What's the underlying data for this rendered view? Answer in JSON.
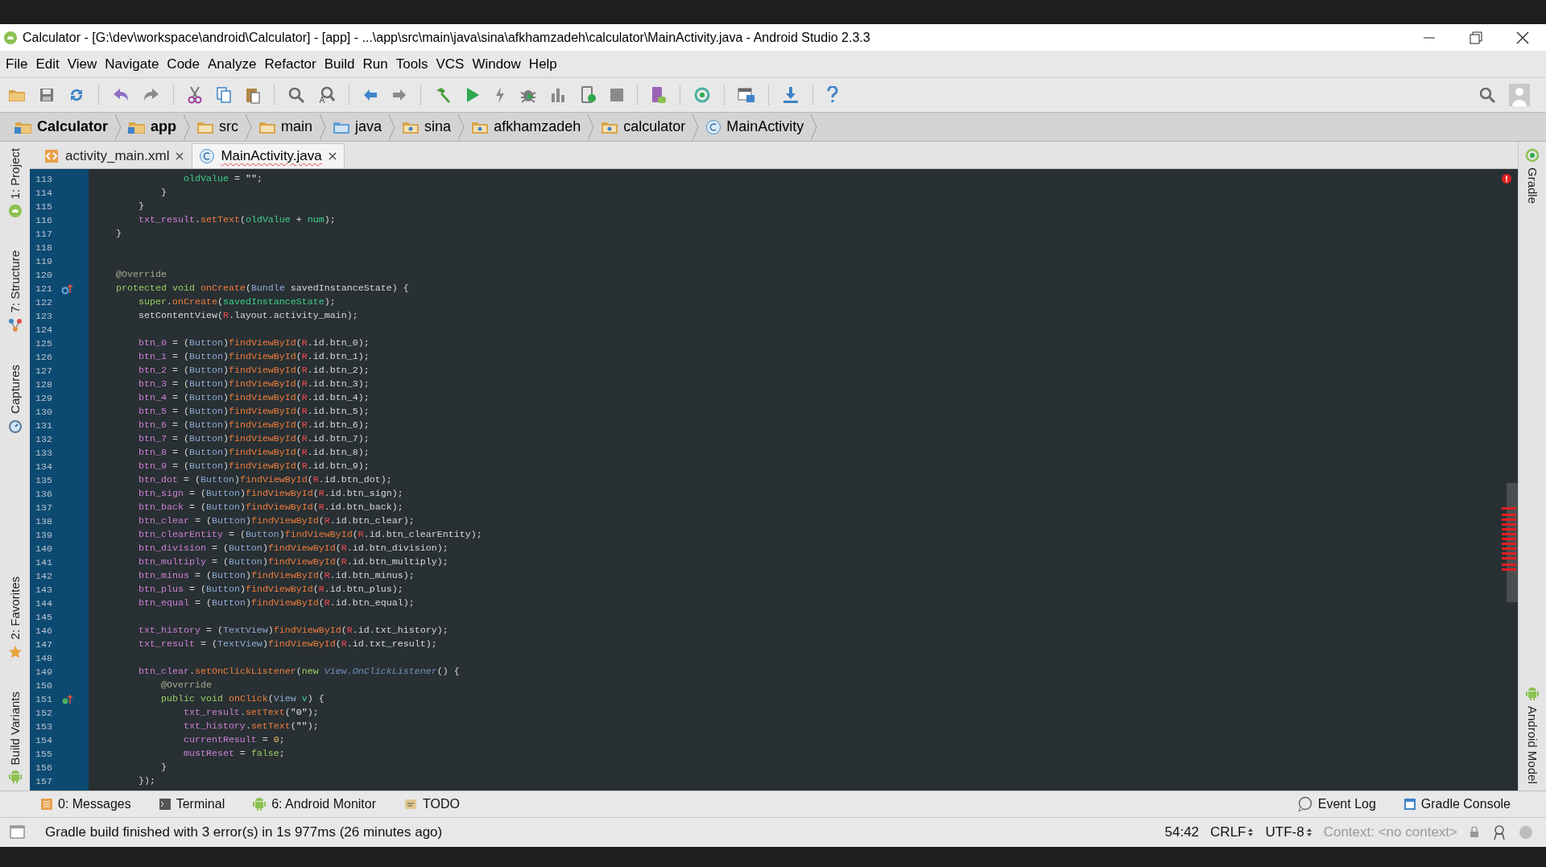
{
  "window": {
    "title": "Calculator - [G:\\dev\\workspace\\android\\Calculator] - [app] - ...\\app\\src\\main\\java\\sina\\afkhamzadeh\\calculator\\MainActivity.java - Android Studio 2.3.3"
  },
  "menu": [
    "File",
    "Edit",
    "View",
    "Navigate",
    "Code",
    "Analyze",
    "Refactor",
    "Build",
    "Run",
    "Tools",
    "VCS",
    "Window",
    "Help"
  ],
  "breadcrumbs": [
    {
      "label": "Calculator",
      "kind": "module"
    },
    {
      "label": "app",
      "kind": "module"
    },
    {
      "label": "src",
      "kind": "folder"
    },
    {
      "label": "main",
      "kind": "folder"
    },
    {
      "label": "java",
      "kind": "source"
    },
    {
      "label": "sina",
      "kind": "package"
    },
    {
      "label": "afkhamzadeh",
      "kind": "package"
    },
    {
      "label": "calculator",
      "kind": "package"
    },
    {
      "label": "MainActivity",
      "kind": "class"
    }
  ],
  "tabs": [
    {
      "label": "activity_main.xml",
      "kind": "xml",
      "selected": false
    },
    {
      "label": "MainActivity.java",
      "kind": "class",
      "selected": true
    }
  ],
  "left_toolbar": {
    "top": [
      {
        "label": "1: Project",
        "kind": "project"
      },
      {
        "label": "7: Structure",
        "kind": "structure"
      },
      {
        "label": "Captures",
        "kind": "captures"
      }
    ],
    "bottom": [
      {
        "label": "2: Favorites",
        "kind": "favorites"
      },
      {
        "label": "Build Variants",
        "kind": "android"
      }
    ]
  },
  "right_toolbar": {
    "top": [
      {
        "label": "Gradle",
        "kind": "gradle"
      }
    ],
    "bottom": [
      {
        "label": "Android Model",
        "kind": "android"
      }
    ]
  },
  "code": [
    {
      "number": "113",
      "tokens": [
        {
          "kind": "local",
          "text": "                oldValue"
        },
        {
          "kind": "plain",
          "text": " = "
        },
        {
          "kind": "string",
          "text": "\"\""
        },
        {
          "kind": "plain",
          "text": ";"
        }
      ]
    },
    {
      "number": "114",
      "tokens": [
        {
          "kind": "plain",
          "text": "            }"
        }
      ]
    },
    {
      "number": "115",
      "tokens": [
        {
          "kind": "plain",
          "text": "        }"
        }
      ]
    },
    {
      "number": "116",
      "tokens": [
        {
          "kind": "field",
          "text": "        txt_result"
        },
        {
          "kind": "plain",
          "text": "."
        },
        {
          "kind": "method",
          "text": "setText"
        },
        {
          "kind": "plain",
          "text": "("
        },
        {
          "kind": "local",
          "text": "oldValue"
        },
        {
          "kind": "plain",
          "text": " + "
        },
        {
          "kind": "local",
          "text": "num"
        },
        {
          "kind": "plain",
          "text": ");"
        }
      ]
    },
    {
      "number": "117",
      "tokens": [
        {
          "kind": "plain",
          "text": "    }"
        }
      ]
    },
    {
      "number": "118"
    },
    {
      "number": "119"
    },
    {
      "number": "120",
      "tokens": [
        {
          "kind": "annotation",
          "text": "    @Override"
        }
      ]
    },
    {
      "number": "121",
      "marker": {
        "kind": "overrides"
      },
      "tokens": [
        {
          "kind": "keyword",
          "text": "    protected void "
        },
        {
          "kind": "method",
          "text": "onCreate"
        },
        {
          "kind": "plain",
          "text": "("
        },
        {
          "kind": "type",
          "text": "Bundle"
        },
        {
          "kind": "plain",
          "text": " savedInstanceState) {"
        }
      ]
    },
    {
      "number": "122",
      "tokens": [
        {
          "kind": "keyword",
          "text": "        super"
        },
        {
          "kind": "plain",
          "text": "."
        },
        {
          "kind": "method",
          "text": "onCreate"
        },
        {
          "kind": "plain",
          "text": "("
        },
        {
          "kind": "local",
          "text": "savedInstanceState"
        },
        {
          "kind": "plain",
          "text": ");"
        }
      ]
    },
    {
      "number": "123",
      "tokens": [
        {
          "kind": "plain",
          "text": "        setContentView("
        },
        {
          "kind": "constant",
          "text": "R"
        },
        {
          "kind": "plain",
          "text": ".layout.activity_main);"
        }
      ]
    },
    {
      "number": "124"
    },
    {
      "number": "125",
      "tokens": [
        {
          "kind": "field",
          "text": "        btn_0"
        },
        {
          "kind": "plain",
          "text": " = ("
        },
        {
          "kind": "type",
          "text": "Button"
        },
        {
          "kind": "plain",
          "text": ")"
        },
        {
          "kind": "method",
          "text": "findViewById"
        },
        {
          "kind": "plain",
          "text": "("
        },
        {
          "kind": "constant",
          "text": "R"
        },
        {
          "kind": "plain",
          "text": ".id.btn_0);"
        }
      ]
    },
    {
      "number": "126",
      "tokens": [
        {
          "kind": "field",
          "text": "        btn_1"
        },
        {
          "kind": "plain",
          "text": " = ("
        },
        {
          "kind": "type",
          "text": "Button"
        },
        {
          "kind": "plain",
          "text": ")"
        },
        {
          "kind": "method",
          "text": "findViewById"
        },
        {
          "kind": "plain",
          "text": "("
        },
        {
          "kind": "constant",
          "text": "R"
        },
        {
          "kind": "plain",
          "text": ".id.btn_1);"
        }
      ]
    },
    {
      "number": "127",
      "tokens": [
        {
          "kind": "field",
          "text": "        btn_2"
        },
        {
          "kind": "plain",
          "text": " = ("
        },
        {
          "kind": "type",
          "text": "Button"
        },
        {
          "kind": "plain",
          "text": ")"
        },
        {
          "kind": "method",
          "text": "findViewById"
        },
        {
          "kind": "plain",
          "text": "("
        },
        {
          "kind": "constant",
          "text": "R"
        },
        {
          "kind": "plain",
          "text": ".id.btn_2);"
        }
      ]
    },
    {
      "number": "128",
      "tokens": [
        {
          "kind": "field",
          "text": "        btn_3"
        },
        {
          "kind": "plain",
          "text": " = ("
        },
        {
          "kind": "type",
          "text": "Button"
        },
        {
          "kind": "plain",
          "text": ")"
        },
        {
          "kind": "method",
          "text": "findViewById"
        },
        {
          "kind": "plain",
          "text": "("
        },
        {
          "kind": "constant",
          "text": "R"
        },
        {
          "kind": "plain",
          "text": ".id.btn_3);"
        }
      ]
    },
    {
      "number": "129",
      "tokens": [
        {
          "kind": "field",
          "text": "        btn_4"
        },
        {
          "kind": "plain",
          "text": " = ("
        },
        {
          "kind": "type",
          "text": "Button"
        },
        {
          "kind": "plain",
          "text": ")"
        },
        {
          "kind": "method",
          "text": "findViewById"
        },
        {
          "kind": "plain",
          "text": "("
        },
        {
          "kind": "constant",
          "text": "R"
        },
        {
          "kind": "plain",
          "text": ".id.btn_4);"
        }
      ]
    },
    {
      "number": "130",
      "tokens": [
        {
          "kind": "field",
          "text": "        btn_5"
        },
        {
          "kind": "plain",
          "text": " = ("
        },
        {
          "kind": "type",
          "text": "Button"
        },
        {
          "kind": "plain",
          "text": ")"
        },
        {
          "kind": "method",
          "text": "findViewById"
        },
        {
          "kind": "plain",
          "text": "("
        },
        {
          "kind": "constant",
          "text": "R"
        },
        {
          "kind": "plain",
          "text": ".id.btn_5);"
        }
      ]
    },
    {
      "number": "131",
      "tokens": [
        {
          "kind": "field",
          "text": "        btn_6"
        },
        {
          "kind": "plain",
          "text": " = ("
        },
        {
          "kind": "type",
          "text": "Button"
        },
        {
          "kind": "plain",
          "text": ")"
        },
        {
          "kind": "method",
          "text": "findViewById"
        },
        {
          "kind": "plain",
          "text": "("
        },
        {
          "kind": "constant",
          "text": "R"
        },
        {
          "kind": "plain",
          "text": ".id.btn_6);"
        }
      ]
    },
    {
      "number": "132",
      "tokens": [
        {
          "kind": "field",
          "text": "        btn_7"
        },
        {
          "kind": "plain",
          "text": " = ("
        },
        {
          "kind": "type",
          "text": "Button"
        },
        {
          "kind": "plain",
          "text": ")"
        },
        {
          "kind": "method",
          "text": "findViewById"
        },
        {
          "kind": "plain",
          "text": "("
        },
        {
          "kind": "constant",
          "text": "R"
        },
        {
          "kind": "plain",
          "text": ".id.btn_7);"
        }
      ]
    },
    {
      "number": "133",
      "tokens": [
        {
          "kind": "field",
          "text": "        btn_8"
        },
        {
          "kind": "plain",
          "text": " = ("
        },
        {
          "kind": "type",
          "text": "Button"
        },
        {
          "kind": "plain",
          "text": ")"
        },
        {
          "kind": "method",
          "text": "findViewById"
        },
        {
          "kind": "plain",
          "text": "("
        },
        {
          "kind": "constant",
          "text": "R"
        },
        {
          "kind": "plain",
          "text": ".id.btn_8);"
        }
      ]
    },
    {
      "number": "134",
      "tokens": [
        {
          "kind": "field",
          "text": "        btn_9"
        },
        {
          "kind": "plain",
          "text": " = ("
        },
        {
          "kind": "type",
          "text": "Button"
        },
        {
          "kind": "plain",
          "text": ")"
        },
        {
          "kind": "method",
          "text": "findViewById"
        },
        {
          "kind": "plain",
          "text": "("
        },
        {
          "kind": "constant",
          "text": "R"
        },
        {
          "kind": "plain",
          "text": ".id.btn_9);"
        }
      ]
    },
    {
      "number": "135",
      "tokens": [
        {
          "kind": "field",
          "text": "        btn_dot"
        },
        {
          "kind": "plain",
          "text": " = ("
        },
        {
          "kind": "type",
          "text": "Button"
        },
        {
          "kind": "plain",
          "text": ")"
        },
        {
          "kind": "method",
          "text": "findViewById"
        },
        {
          "kind": "plain",
          "text": "("
        },
        {
          "kind": "constant",
          "text": "R"
        },
        {
          "kind": "plain",
          "text": ".id.btn_dot);"
        }
      ]
    },
    {
      "number": "136",
      "tokens": [
        {
          "kind": "field",
          "text": "        btn_sign"
        },
        {
          "kind": "plain",
          "text": " = ("
        },
        {
          "kind": "type",
          "text": "Button"
        },
        {
          "kind": "plain",
          "text": ")"
        },
        {
          "kind": "method",
          "text": "findViewById"
        },
        {
          "kind": "plain",
          "text": "("
        },
        {
          "kind": "constant",
          "text": "R"
        },
        {
          "kind": "plain",
          "text": ".id.btn_sign);"
        }
      ]
    },
    {
      "number": "137",
      "tokens": [
        {
          "kind": "field",
          "text": "        btn_back"
        },
        {
          "kind": "plain",
          "text": " = ("
        },
        {
          "kind": "type",
          "text": "Button"
        },
        {
          "kind": "plain",
          "text": ")"
        },
        {
          "kind": "method",
          "text": "findViewById"
        },
        {
          "kind": "plain",
          "text": "("
        },
        {
          "kind": "constant",
          "text": "R"
        },
        {
          "kind": "plain",
          "text": ".id.btn_back);"
        }
      ]
    },
    {
      "number": "138",
      "tokens": [
        {
          "kind": "field",
          "text": "        btn_clear"
        },
        {
          "kind": "plain",
          "text": " = ("
        },
        {
          "kind": "type",
          "text": "Button"
        },
        {
          "kind": "plain",
          "text": ")"
        },
        {
          "kind": "method",
          "text": "findViewById"
        },
        {
          "kind": "plain",
          "text": "("
        },
        {
          "kind": "constant",
          "text": "R"
        },
        {
          "kind": "plain",
          "text": ".id.btn_clear);"
        }
      ]
    },
    {
      "number": "139",
      "tokens": [
        {
          "kind": "field",
          "text": "        btn_clearEntity"
        },
        {
          "kind": "plain",
          "text": " = ("
        },
        {
          "kind": "type",
          "text": "Button"
        },
        {
          "kind": "plain",
          "text": ")"
        },
        {
          "kind": "method",
          "text": "findViewById"
        },
        {
          "kind": "plain",
          "text": "("
        },
        {
          "kind": "constant",
          "text": "R"
        },
        {
          "kind": "plain",
          "text": ".id.btn_clearEntity);"
        }
      ]
    },
    {
      "number": "140",
      "tokens": [
        {
          "kind": "field",
          "text": "        btn_division"
        },
        {
          "kind": "plain",
          "text": " = ("
        },
        {
          "kind": "type",
          "text": "Button"
        },
        {
          "kind": "plain",
          "text": ")"
        },
        {
          "kind": "method",
          "text": "findViewById"
        },
        {
          "kind": "plain",
          "text": "("
        },
        {
          "kind": "constant",
          "text": "R"
        },
        {
          "kind": "plain",
          "text": ".id.btn_division);"
        }
      ]
    },
    {
      "number": "141",
      "tokens": [
        {
          "kind": "field",
          "text": "        btn_multiply"
        },
        {
          "kind": "plain",
          "text": " = ("
        },
        {
          "kind": "type",
          "text": "Button"
        },
        {
          "kind": "plain",
          "text": ")"
        },
        {
          "kind": "method",
          "text": "findViewById"
        },
        {
          "kind": "plain",
          "text": "("
        },
        {
          "kind": "constant",
          "text": "R"
        },
        {
          "kind": "plain",
          "text": ".id.btn_multiply);"
        }
      ]
    },
    {
      "number": "142",
      "tokens": [
        {
          "kind": "field",
          "text": "        btn_minus"
        },
        {
          "kind": "plain",
          "text": " = ("
        },
        {
          "kind": "type",
          "text": "Button"
        },
        {
          "kind": "plain",
          "text": ")"
        },
        {
          "kind": "method",
          "text": "findViewById"
        },
        {
          "kind": "plain",
          "text": "("
        },
        {
          "kind": "constant",
          "text": "R"
        },
        {
          "kind": "plain",
          "text": ".id.btn_minus);"
        }
      ]
    },
    {
      "number": "143",
      "tokens": [
        {
          "kind": "field",
          "text": "        btn_plus"
        },
        {
          "kind": "plain",
          "text": " = ("
        },
        {
          "kind": "type",
          "text": "Button"
        },
        {
          "kind": "plain",
          "text": ")"
        },
        {
          "kind": "method",
          "text": "findViewById"
        },
        {
          "kind": "plain",
          "text": "("
        },
        {
          "kind": "constant",
          "text": "R"
        },
        {
          "kind": "plain",
          "text": ".id.btn_plus);"
        }
      ]
    },
    {
      "number": "144",
      "tokens": [
        {
          "kind": "field",
          "text": "        btn_equal"
        },
        {
          "kind": "plain",
          "text": " = ("
        },
        {
          "kind": "type",
          "text": "Button"
        },
        {
          "kind": "plain",
          "text": ")"
        },
        {
          "kind": "method",
          "text": "findViewById"
        },
        {
          "kind": "plain",
          "text": "("
        },
        {
          "kind": "constant",
          "text": "R"
        },
        {
          "kind": "plain",
          "text": ".id.btn_equal);"
        }
      ]
    },
    {
      "number": "145"
    },
    {
      "number": "146",
      "tokens": [
        {
          "kind": "field",
          "text": "        txt_history"
        },
        {
          "kind": "plain",
          "text": " = ("
        },
        {
          "kind": "type",
          "text": "TextView"
        },
        {
          "kind": "plain",
          "text": ")"
        },
        {
          "kind": "method",
          "text": "findViewById"
        },
        {
          "kind": "plain",
          "text": "("
        },
        {
          "kind": "constant",
          "text": "R"
        },
        {
          "kind": "plain",
          "text": ".id.txt_history);"
        }
      ]
    },
    {
      "number": "147",
      "tokens": [
        {
          "kind": "field",
          "text": "        txt_result"
        },
        {
          "kind": "plain",
          "text": " = ("
        },
        {
          "kind": "type",
          "text": "TextView"
        },
        {
          "kind": "plain",
          "text": ")"
        },
        {
          "kind": "method",
          "text": "findViewById"
        },
        {
          "kind": "plain",
          "text": "("
        },
        {
          "kind": "constant",
          "text": "R"
        },
        {
          "kind": "plain",
          "text": ".id.txt_result);"
        }
      ]
    },
    {
      "number": "148"
    },
    {
      "number": "149",
      "tokens": [
        {
          "kind": "field",
          "text": "        btn_clear"
        },
        {
          "kind": "plain",
          "text": "."
        },
        {
          "kind": "method",
          "text": "setOnClickListener"
        },
        {
          "kind": "plain",
          "text": "("
        },
        {
          "kind": "keyword",
          "text": "new "
        },
        {
          "kind": "interface",
          "text": "View.OnClickListener"
        },
        {
          "kind": "plain",
          "text": "() {"
        }
      ]
    },
    {
      "number": "150",
      "tokens": [
        {
          "kind": "annotation",
          "text": "            @Override"
        }
      ]
    },
    {
      "number": "151",
      "marker": {
        "kind": "implements"
      },
      "tokens": [
        {
          "kind": "keyword",
          "text": "            public void "
        },
        {
          "kind": "method",
          "text": "onClick"
        },
        {
          "kind": "plain",
          "text": "("
        },
        {
          "kind": "type",
          "text": "View"
        },
        {
          "kind": "local",
          "text": " v"
        },
        {
          "kind": "plain",
          "text": ") {"
        }
      ]
    },
    {
      "number": "152",
      "tokens": [
        {
          "kind": "field",
          "text": "                txt_result"
        },
        {
          "kind": "plain",
          "text": "."
        },
        {
          "kind": "method",
          "text": "setText"
        },
        {
          "kind": "plain",
          "text": "("
        },
        {
          "kind": "string",
          "text": "\"0\""
        },
        {
          "kind": "plain",
          "text": ");"
        }
      ]
    },
    {
      "number": "153",
      "tokens": [
        {
          "kind": "field",
          "text": "                txt_history"
        },
        {
          "kind": "plain",
          "text": "."
        },
        {
          "kind": "method",
          "text": "setText"
        },
        {
          "kind": "plain",
          "text": "("
        },
        {
          "kind": "string",
          "text": "\"\""
        },
        {
          "kind": "plain",
          "text": ");"
        }
      ]
    },
    {
      "number": "154",
      "tokens": [
        {
          "kind": "field",
          "text": "                currentResult"
        },
        {
          "kind": "plain",
          "text": " = "
        },
        {
          "kind": "number",
          "text": "0"
        },
        {
          "kind": "plain",
          "text": ";"
        }
      ]
    },
    {
      "number": "155",
      "tokens": [
        {
          "kind": "field",
          "text": "                mustReset"
        },
        {
          "kind": "plain",
          "text": " = "
        },
        {
          "kind": "keyword",
          "text": "false"
        },
        {
          "kind": "plain",
          "text": ";"
        }
      ]
    },
    {
      "number": "156",
      "tokens": [
        {
          "kind": "plain",
          "text": "            }"
        }
      ]
    },
    {
      "number": "157",
      "tokens": [
        {
          "kind": "plain",
          "text": "        });"
        }
      ]
    }
  ],
  "tool_tabs": {
    "left": [
      {
        "label": "0: Messages",
        "kind": "messages"
      },
      {
        "label": "Terminal",
        "kind": "terminal"
      },
      {
        "label": "6: Android Monitor",
        "kind": "android"
      },
      {
        "label": "TODO",
        "kind": "todo"
      }
    ],
    "right": [
      {
        "label": "Event Log",
        "kind": "eventlog"
      },
      {
        "label": "Gradle Console",
        "kind": "console"
      }
    ]
  },
  "status_bar": {
    "message": "Gradle build finished with 3 error(s) in 1s 977ms (26 minutes ago)",
    "position": "54:42",
    "line_separator": "CRLF",
    "encoding": "UTF-8",
    "context": "Context: <no context>"
  }
}
